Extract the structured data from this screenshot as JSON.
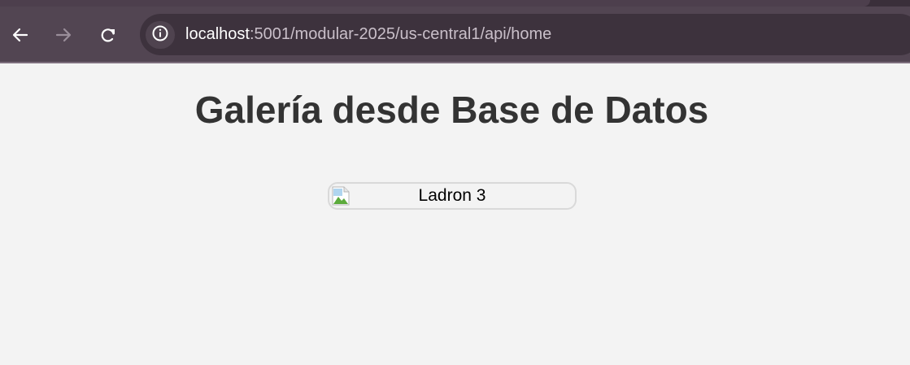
{
  "browser": {
    "url_host": "localhost",
    "url_rest": ":5001/modular-2025/us-central1/api/home",
    "icons": {
      "back": "arrow-left-icon",
      "forward": "arrow-right-icon",
      "reload": "reload-icon",
      "site_info": "info-icon"
    }
  },
  "page": {
    "title": "Galería desde Base de Datos",
    "gallery": [
      {
        "alt": "Ladron 3",
        "image_state": "broken-image-icon"
      }
    ]
  },
  "colors": {
    "toolbar": "#524552",
    "omnibox": "#3d323d",
    "page_background": "#f3f3f3",
    "title_text": "#333333",
    "card_border": "#d9d9d9"
  }
}
